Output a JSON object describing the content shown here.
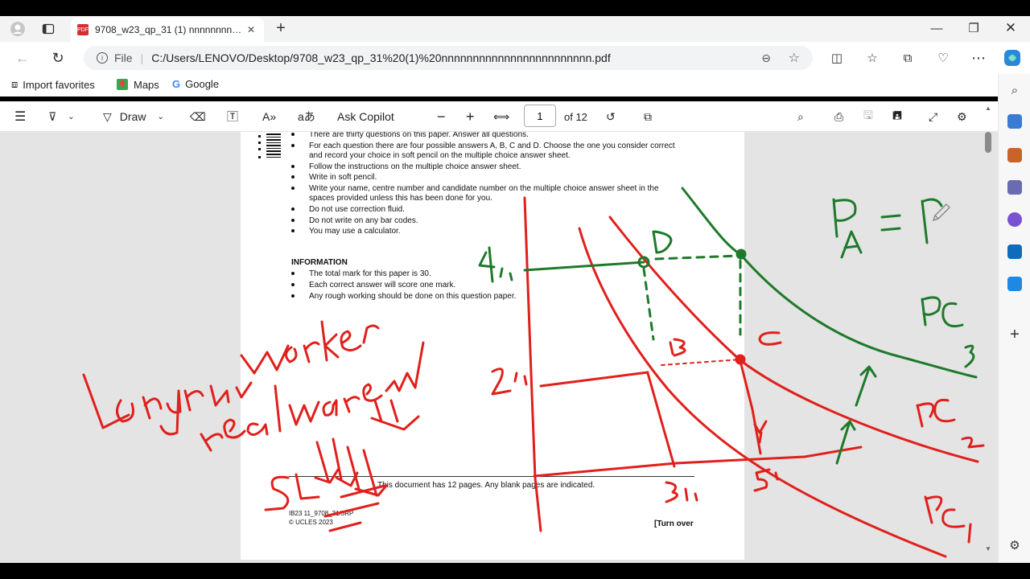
{
  "browser": {
    "tab_title": "9708_w23_qp_31 (1) nnnnnnnnnnnnnnnnnnnnnnnnn",
    "address_prefix": "File",
    "address": "C:/Users/LENOVO/Desktop/9708_w23_qp_31%20(1)%20nnnnnnnnnnnnnnnnnnnnnnnn.pdf",
    "bookmarks": [
      "Import favorites",
      "Maps",
      "Google"
    ]
  },
  "pdf_toolbar": {
    "draw_label": "Draw",
    "copilot_label": "Ask Copilot",
    "page_number": "1",
    "page_total": "of 12"
  },
  "document": {
    "instructions": [
      "There are thirty questions on this paper. Answer all questions.",
      "For each question there are four possible answers A, B, C and D. Choose the one you consider correct",
      "and record your choice in soft pencil on the multiple choice answer sheet.",
      "Follow the instructions on the multiple choice answer sheet.",
      "Write in soft pencil.",
      "Write your name, centre number and candidate number on the multiple choice answer sheet in the",
      "spaces provided unless this has been done for you.",
      "Do not use correction fluid.",
      "Do not write on any bar codes.",
      "You may use a calculator."
    ],
    "info_heading": "INFORMATION",
    "info_items": [
      "The total mark for this paper is 30.",
      "Each correct answer will score one mark.",
      "Any rough working should be done on this question paper."
    ],
    "footer_line": "This document has 12 pages. Any blank pages are indicated.",
    "footer_code": "IB23 11_9708_31/3RP",
    "footer_copyright": "© UCLES 2023",
    "turn_over": "[Turn over"
  },
  "annotations": {
    "labels": [
      "D",
      "C",
      "B",
      "4%",
      "2%",
      "3%",
      "5%",
      "PA = P",
      "PC3",
      "PC2",
      "PC1"
    ],
    "handwriting": [
      "Long run Worker",
      "real wages",
      "SL"
    ],
    "colors": {
      "red": "#e0201c",
      "green": "#1e7a2a"
    }
  }
}
